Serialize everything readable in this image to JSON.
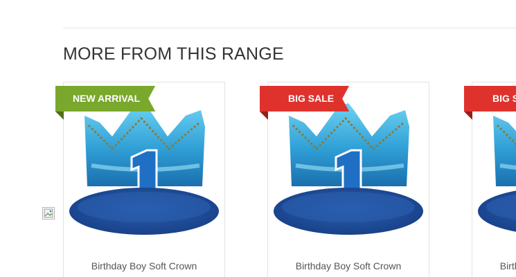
{
  "section": {
    "title": "MORE FROM THIS RANGE"
  },
  "products": [
    {
      "name": "Birthday Boy Soft Crown",
      "badge": "NEW ARRIVAL",
      "badge_color": "#79a82c"
    },
    {
      "name": "Birthday Boy Soft Crown",
      "badge": "BIG SALE",
      "badge_color": "#e0322d"
    },
    {
      "name": "Birthday Boy Soft Crown",
      "badge": "BIG SALE",
      "badge_color": "#e0322d"
    }
  ],
  "icons": {
    "broken_image": "broken-image-icon"
  }
}
